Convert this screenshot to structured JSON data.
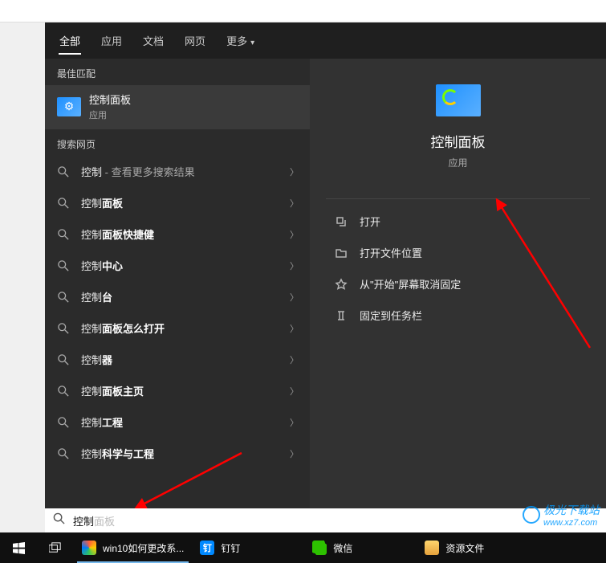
{
  "tabs": {
    "all": "全部",
    "apps": "应用",
    "docs": "文档",
    "web": "网页",
    "more": "更多"
  },
  "left": {
    "bestHeader": "最佳匹配",
    "bestTitle": "控制面板",
    "bestSub": "应用",
    "webHeader": "搜索网页",
    "items": [
      {
        "prefix": "控制",
        "bold": "",
        "suffix": " - 查看更多搜索结果"
      },
      {
        "prefix": "控制",
        "bold": "面板",
        "suffix": ""
      },
      {
        "prefix": "控制",
        "bold": "面板快捷健",
        "suffix": ""
      },
      {
        "prefix": "控制",
        "bold": "中心",
        "suffix": ""
      },
      {
        "prefix": "控制",
        "bold": "台",
        "suffix": ""
      },
      {
        "prefix": "控制",
        "bold": "面板怎么打开",
        "suffix": ""
      },
      {
        "prefix": "控制",
        "bold": "器",
        "suffix": ""
      },
      {
        "prefix": "控制",
        "bold": "面板主页",
        "suffix": ""
      },
      {
        "prefix": "控制",
        "bold": "工程",
        "suffix": ""
      },
      {
        "prefix": "控制",
        "bold": "科学与工程",
        "suffix": ""
      }
    ]
  },
  "right": {
    "title": "控制面板",
    "sub": "应用",
    "actions": {
      "open": "打开",
      "openLoc": "打开文件位置",
      "unpin": "从\"开始\"屏幕取消固定",
      "pinTaskbar": "固定到任务栏"
    }
  },
  "search": {
    "typed": "控制",
    "ghost": "面板"
  },
  "taskbar": {
    "browser": "win10如何更改系...",
    "dingding": "钉钉",
    "wechat": "微信",
    "folder": "资源文件"
  },
  "watermark": {
    "line1": "极光下载站",
    "line2": "www.xz7.com"
  }
}
